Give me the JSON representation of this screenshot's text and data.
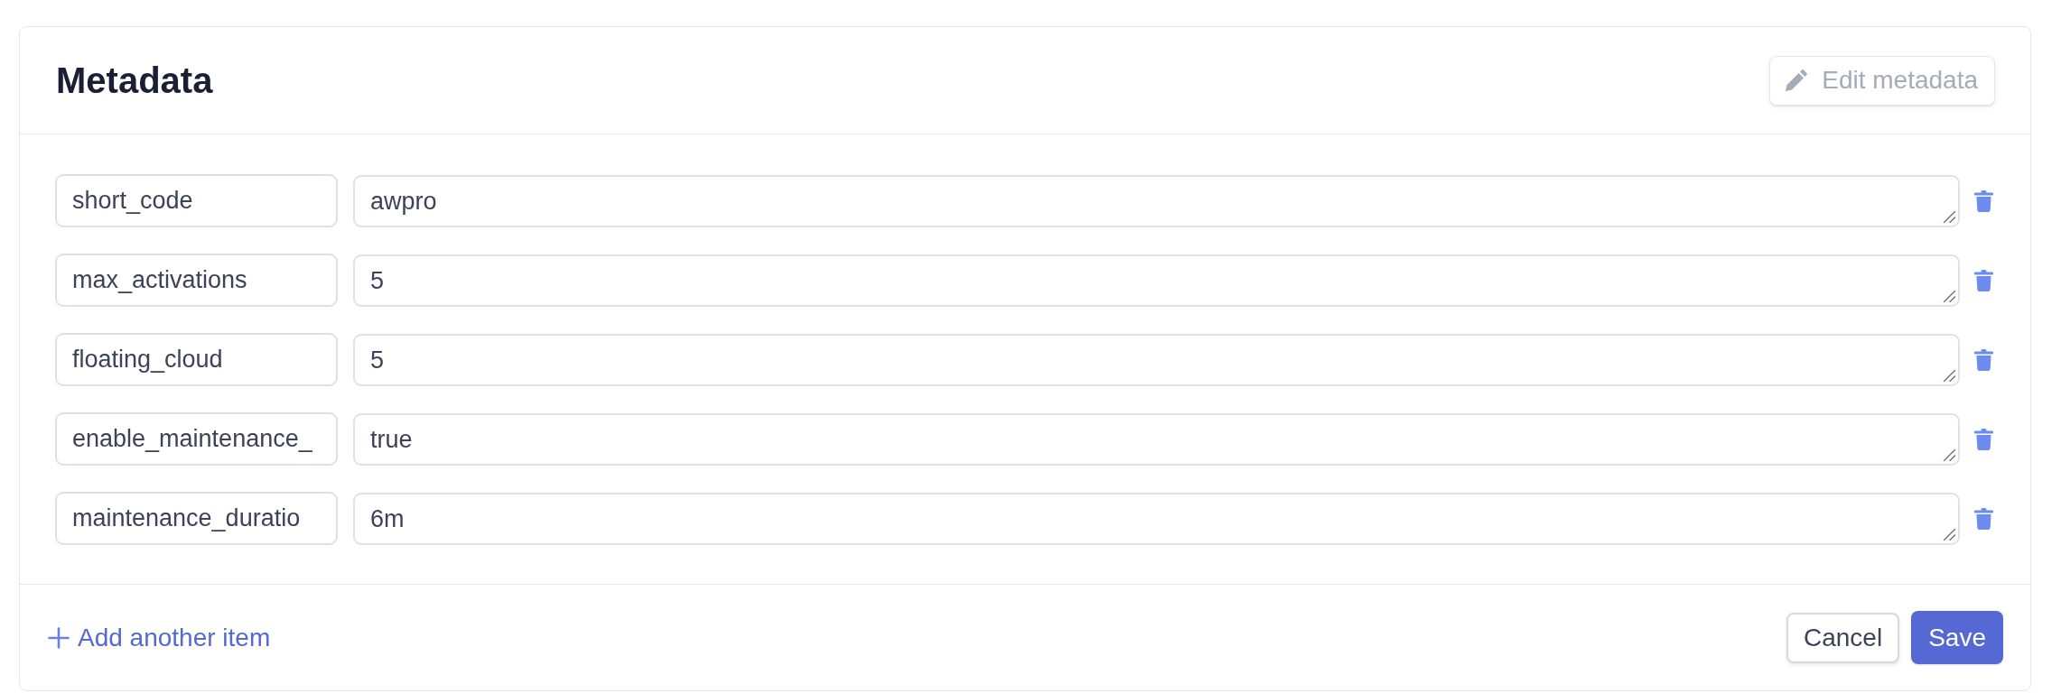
{
  "card": {
    "title": "Metadata",
    "edit_button": {
      "label": "Edit metadata",
      "disabled": true
    }
  },
  "items": [
    {
      "key": "short_code",
      "value": "awpro"
    },
    {
      "key": "max_activations",
      "value": "5"
    },
    {
      "key": "floating_cloud",
      "value": "5"
    },
    {
      "key": "enable_maintenance_",
      "value": "true"
    },
    {
      "key": "maintenance_duratio",
      "value": "6m"
    }
  ],
  "footer": {
    "add_link": "Add another item",
    "buttons": [
      {
        "label": "Cancel",
        "kind": "secondary"
      },
      {
        "label": "Save",
        "kind": "primary"
      }
    ]
  }
}
